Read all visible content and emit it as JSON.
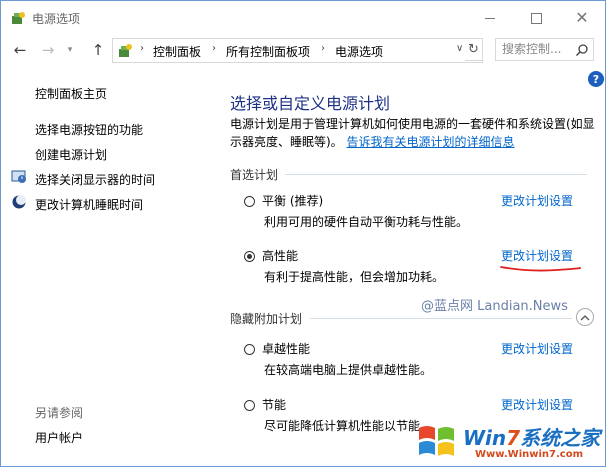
{
  "window": {
    "title": "电源选项"
  },
  "address": {
    "crumbs": [
      "控制面板",
      "所有控制面板项",
      "电源选项"
    ],
    "search_placeholder": "搜索控制..."
  },
  "sidebar": {
    "home": "控制面板主页",
    "links": [
      "选择电源按钮的功能",
      "创建电源计划",
      "选择关闭显示器的时间",
      "更改计算机睡眠时间"
    ],
    "see_also_label": "另请参阅",
    "see_also_links": [
      "用户帐户"
    ]
  },
  "main": {
    "heading": "选择或自定义电源计划",
    "description": "电源计划是用于管理计算机如何使用电源的一套硬件和系统设置(如显示器亮度、睡眠等)。",
    "description_link": "告诉我有关电源计划的详细信息",
    "preferred_label": "首选计划",
    "hidden_label": "隐藏附加计划",
    "plans": [
      {
        "name": "平衡 (推荐)",
        "desc": "利用可用的硬件自动平衡功耗与性能。",
        "link": "更改计划设置",
        "selected": false
      },
      {
        "name": "高性能",
        "desc": "有利于提高性能，但会增加功耗。",
        "link": "更改计划设置",
        "selected": true
      },
      {
        "name": "卓越性能",
        "desc": "在较高端电脑上提供卓越性能。",
        "link": "更改计划设置",
        "selected": false
      },
      {
        "name": "节能",
        "desc": "尽可能降低计算机性能以节能。",
        "link": "更改计划设置",
        "selected": false
      }
    ]
  },
  "watermarks": {
    "text": "@蓝点网 Landian.News",
    "logo_win": "Win",
    "logo_seven": "7",
    "logo_cn": "系统之家",
    "logo_url": "Www.Winwin7.com"
  },
  "colors": {
    "link": "#0066cc",
    "heading": "#1e3287",
    "annotation": "#e02020"
  }
}
